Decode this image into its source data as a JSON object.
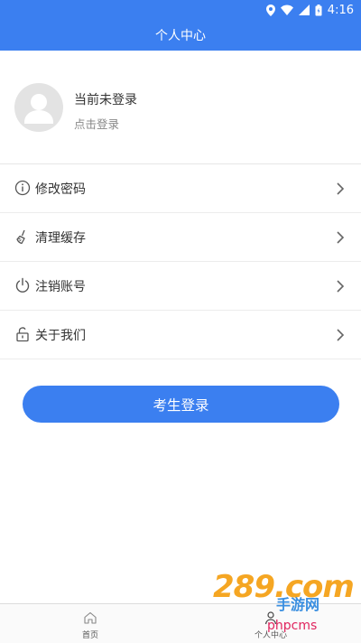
{
  "status_bar": {
    "time": "4:16"
  },
  "app_bar": {
    "title": "个人中心"
  },
  "profile": {
    "status": "当前未登录",
    "hint": "点击登录"
  },
  "menu": [
    {
      "label": "修改密码",
      "icon": "info-circle-icon"
    },
    {
      "label": "清理缓存",
      "icon": "broom-icon"
    },
    {
      "label": "注销账号",
      "icon": "power-icon"
    },
    {
      "label": "关于我们",
      "icon": "lock-icon"
    }
  ],
  "login_button": {
    "label": "考生登录"
  },
  "tabs": [
    {
      "label": "首页",
      "icon": "home-icon"
    },
    {
      "label": "个人中心",
      "icon": "person-icon"
    }
  ],
  "watermark": {
    "brand": "289.com",
    "subtitle": "手游网",
    "tag": "phpcms"
  },
  "colors": {
    "primary": "#3b7ff0"
  }
}
